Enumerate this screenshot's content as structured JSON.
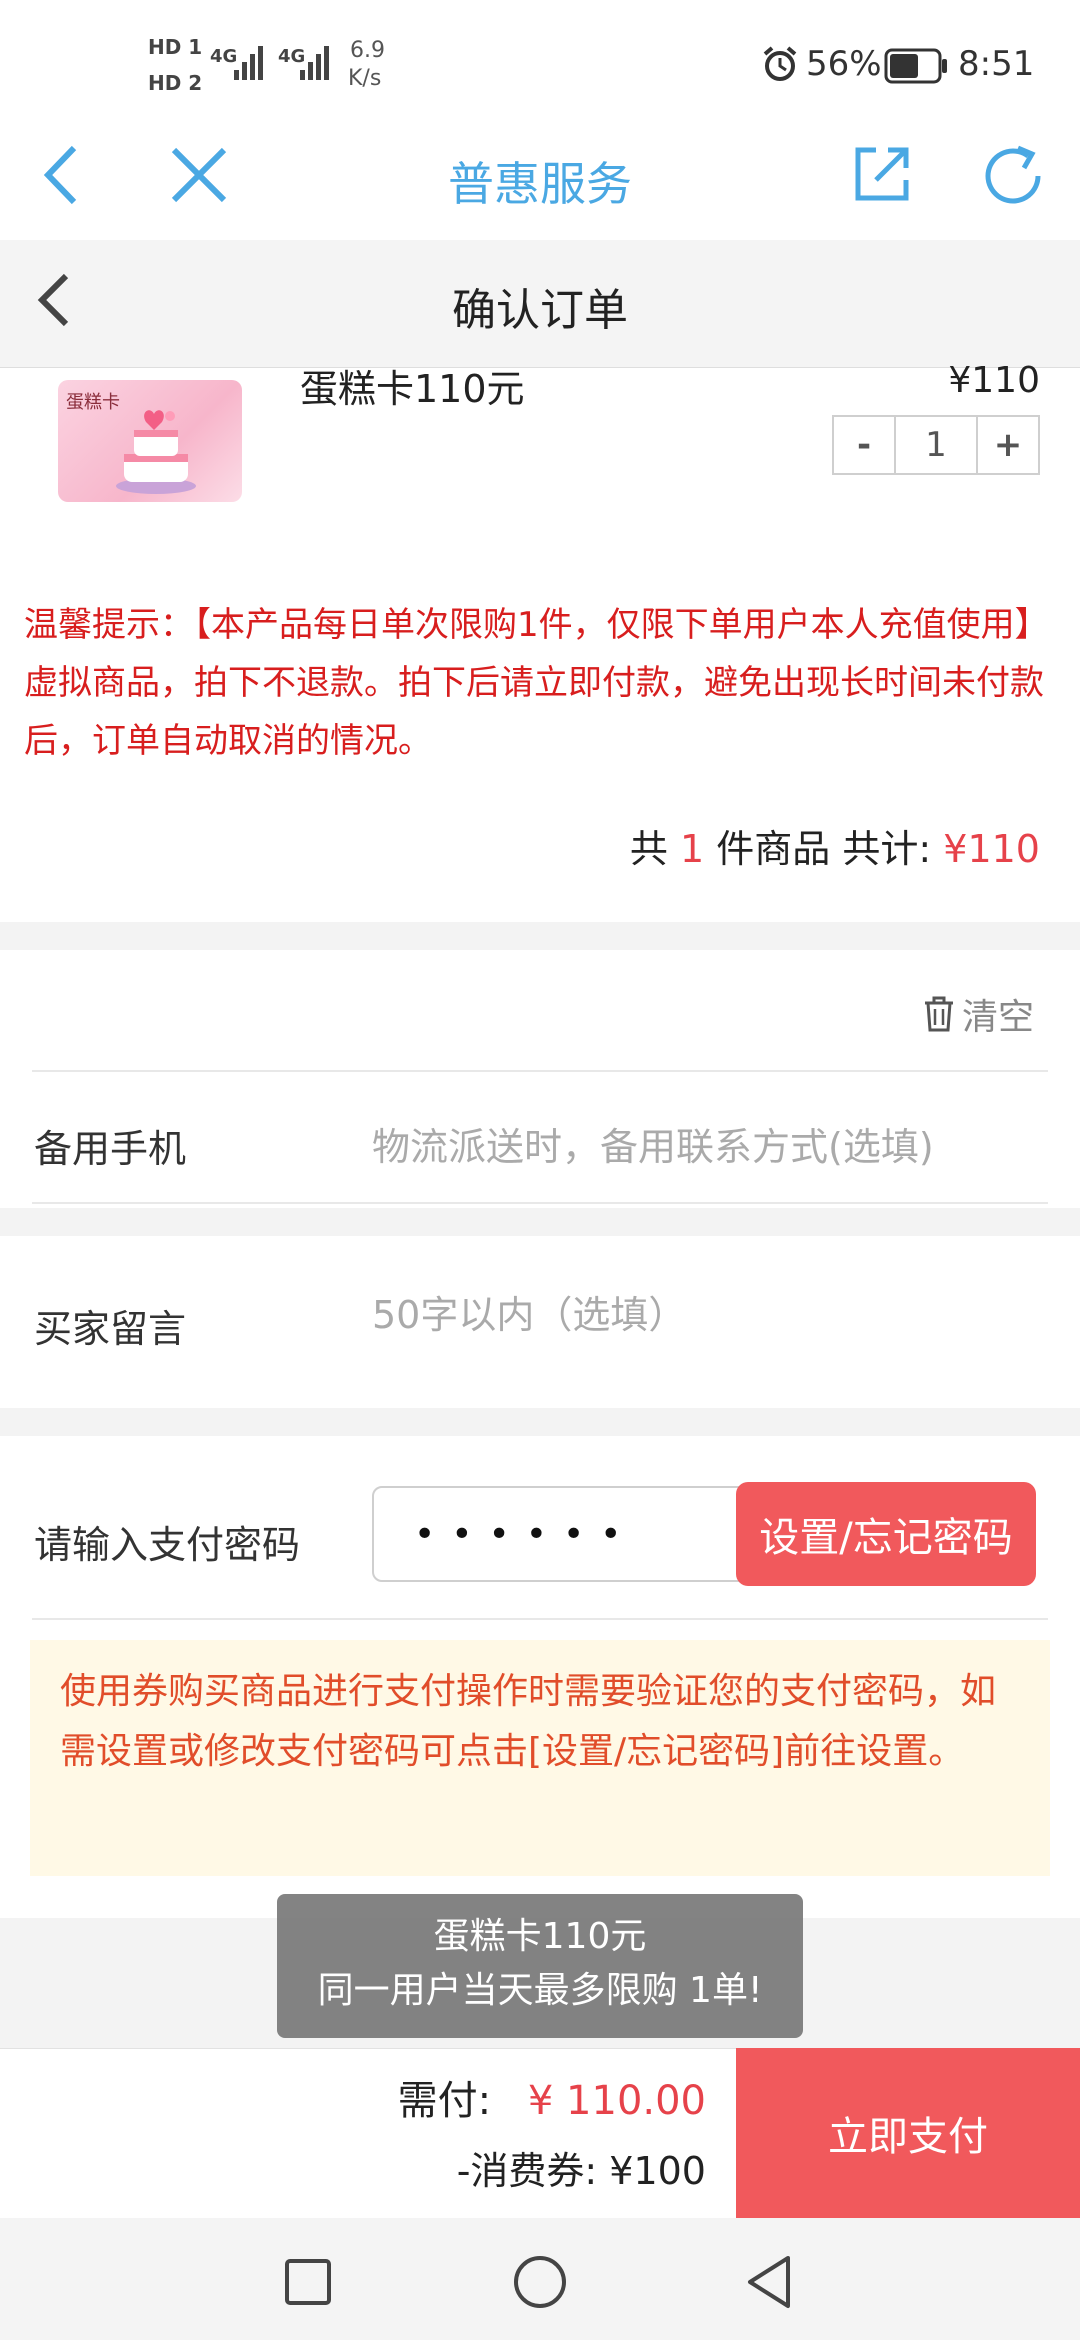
{
  "status_bar": {
    "hd1": "HD 1",
    "hd2": "HD 2",
    "sig1": "4G",
    "sig2": "4G",
    "speed_value": "6.9",
    "speed_unit": "K/s",
    "battery": "56%",
    "time": "8:51"
  },
  "browser": {
    "title": "普惠服务"
  },
  "header": {
    "title": "确认订单"
  },
  "product": {
    "thumb_text": "蛋糕卡",
    "name": "蛋糕卡110元",
    "price": "¥110",
    "quantity": "1",
    "minus": "-",
    "plus": "+"
  },
  "notice": "温馨提示：【本产品每日单次限购1件，仅限下单用户本人充值使用】虚拟商品，拍下不退款。拍下后请立即付款，避免出现长时间未付款后，订单自动取消的情况。",
  "summary": {
    "prefix": "共",
    "count": "1",
    "middle": "件商品 共计:",
    "total": "¥110"
  },
  "form": {
    "clear_label": "清空",
    "phone_label": "备用手机",
    "phone_placeholder": "物流派送时，备用联系方式(选填)",
    "message_label": "买家留言",
    "message_placeholder": "50字以内（选填）",
    "password_label": "请输入支付密码",
    "password_value": "••••••",
    "password_button": "设置/忘记密码",
    "hint": "使用券购买商品进行支付操作时需要验证您的支付密码，如需设置或修改支付密码可点击[设置/忘记密码]前往设置。"
  },
  "toast": {
    "line1": "蛋糕卡110元",
    "line2": "同一用户当天最多限购 1单!"
  },
  "bottom": {
    "due_label": "需付:",
    "due_value": "¥ 110.00",
    "coupon": "-消费券: ¥100",
    "pay_button": "立即支付"
  },
  "colors": {
    "accent_blue": "#4aa8e3",
    "accent_red": "#f1595c",
    "notice_red": "#d81e1e"
  },
  "icons": [
    "back-icon",
    "close-icon",
    "share-icon",
    "refresh-icon",
    "trash-icon",
    "square-icon",
    "circle-icon",
    "triangle-back-icon",
    "alarm-icon",
    "battery-icon"
  ]
}
